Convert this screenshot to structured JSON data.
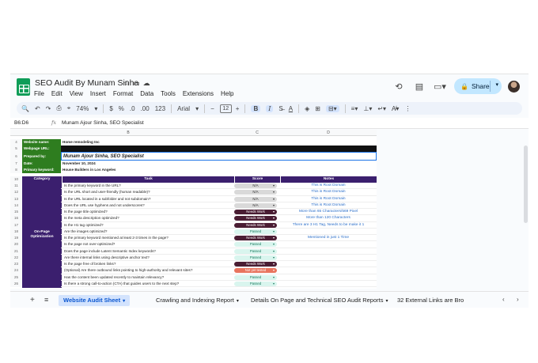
{
  "app": {
    "doc_title": "SEO Audit By Munam Sinha",
    "menus": [
      "File",
      "Edit",
      "View",
      "Insert",
      "Format",
      "Data",
      "Tools",
      "Extensions",
      "Help"
    ],
    "share_label": "Share"
  },
  "toolbar": {
    "zoom": "74%",
    "currency": "$",
    "percent": "%",
    "decrease_decimal": ".0",
    "increase_decimal": ".00",
    "number_format": "123",
    "font": "Arial",
    "font_size": "12",
    "minus": "−",
    "plus": "+",
    "bold": "B",
    "italic": "I",
    "text_color": "A"
  },
  "formula_bar": {
    "name_box": "B6:D6",
    "fx": "fx",
    "value": "Munam Ajour Sinha, SEO Specialist"
  },
  "columns": [
    "B",
    "C",
    "D"
  ],
  "info_rows": [
    {
      "row": "4",
      "label": "Website name:",
      "value": "Home remodeling Inc"
    },
    {
      "row": "5",
      "label": "Webpage URL:",
      "value": ""
    },
    {
      "row": "6",
      "label": "Prepared by:",
      "value": "Munam Ajour Sinha, SEO Specialist"
    },
    {
      "row": "7",
      "label": "Date:",
      "value": "November 10, 2024"
    },
    {
      "row": "8",
      "label": "Primary keyword:",
      "value": "House Builders in Los Angeles"
    }
  ],
  "table_header": {
    "row": "10",
    "category": "Category",
    "task": "Task",
    "score": "Score",
    "notes": "Notes"
  },
  "section": {
    "label": "On-Page Optimization"
  },
  "tasks": [
    {
      "row": "11",
      "task": "Is the primary keyword in the URL?",
      "score": "N/A",
      "status": "na",
      "note": "This is Root Domain"
    },
    {
      "row": "12",
      "task": "Is the URL short and user-friendly (human readable)?",
      "score": "N/A",
      "status": "na",
      "note": "This is Root Domain"
    },
    {
      "row": "13",
      "task": "Is the URL located in a subfolder and not subdomain?",
      "score": "N/A",
      "status": "na",
      "note": "This is Root Domain"
    },
    {
      "row": "14",
      "task": "Does the URL use hyphens and not underscores?",
      "score": "N/A",
      "status": "na",
      "note": "This is Root Domain"
    },
    {
      "row": "15",
      "task": "Is the page title optimized?",
      "score": "Needs Work",
      "status": "nw",
      "note": "More than 65 Characters/569 Pixel"
    },
    {
      "row": "16",
      "task": "Is the meta description optimized?",
      "score": "Needs Work",
      "status": "nw",
      "note": "More than 120 Characters"
    },
    {
      "row": "17",
      "task": "Is the H1 tag optimized?",
      "score": "Needs Work",
      "status": "nw",
      "note": "There are 3 H1 Tag, Needs to be make it 1"
    },
    {
      "row": "18",
      "task": "Are the images optimized?",
      "score": "Passed",
      "status": "ps",
      "note": ""
    },
    {
      "row": "19",
      "task": "Is the primary keyword mentioned at least 2-3 times in the page?",
      "score": "Needs Work",
      "status": "nw",
      "note": "Mentioned in just 1 Time"
    },
    {
      "row": "20",
      "task": "Is the page not over-optimized?",
      "score": "Passed",
      "status": "ps",
      "note": ""
    },
    {
      "row": "21",
      "task": "Does the page include Latent Semantic Index keywords?",
      "score": "Passed",
      "status": "ps",
      "note": ""
    },
    {
      "row": "22",
      "task": "Are there internal links using descriptive anchor text?",
      "score": "Passed",
      "status": "ps",
      "note": ""
    },
    {
      "row": "23",
      "task": "Is the page free of broken links?",
      "score": "Needs Work",
      "status": "nw",
      "note": ""
    },
    {
      "row": "24",
      "task": "(Optional) Are there outbound links pointing to high-authority and relevant sites?",
      "score": "Not yet tested",
      "status": "nt",
      "note": ""
    },
    {
      "row": "25",
      "task": "Has the content been updated recently to maintain relevancy?",
      "score": "Passed",
      "status": "ps",
      "note": ""
    },
    {
      "row": "26",
      "task": "Is there a strong call-to-action (CTA) that guides users to the next step?",
      "score": "Passed",
      "status": "ps",
      "note": ""
    }
  ],
  "sheet_tabs": [
    "Website Audit Sheet",
    "Crawling and Indexing Report",
    "Details On Page and Technical SEO Audit Reports",
    "32 External Links are Bro"
  ],
  "colors": {
    "label_green": "#2e7d1f",
    "header_purple": "#3b1f6e",
    "needs_work": "#4a1d33",
    "passed": "#d9f5ee",
    "not_tested": "#e8745e",
    "note_blue": "#2a6ec9",
    "active_tab": "#d3e3fd"
  }
}
